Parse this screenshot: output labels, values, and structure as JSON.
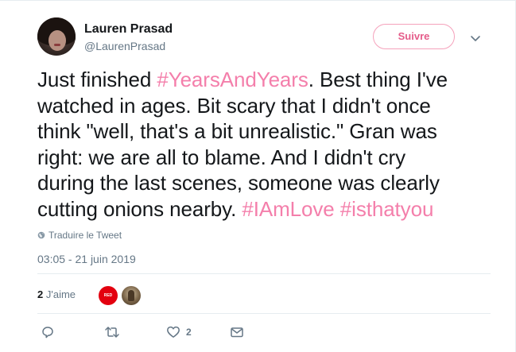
{
  "user": {
    "display_name": "Lauren Prasad",
    "handle": "@LaurenPrasad"
  },
  "follow_label": "Suivre",
  "tweet": {
    "lines": [
      [
        {
          "t": "Just finished ",
          "h": false
        },
        {
          "t": "#YearsAndYears",
          "h": true
        },
        {
          "t": ". Best thing I've",
          "h": false
        }
      ],
      [
        {
          "t": "watched in ages. Bit scary that I didn't once",
          "h": false
        }
      ],
      [
        {
          "t": "think \"well, that's a bit unrealistic.\" Gran was",
          "h": false
        }
      ],
      [
        {
          "t": "right: we are all to blame. And I didn't cry",
          "h": false
        }
      ],
      [
        {
          "t": "during the last scenes, someone was clearly",
          "h": false
        }
      ],
      [
        {
          "t": "cutting onions nearby. ",
          "h": false
        },
        {
          "t": "#IAmLove",
          "h": true
        },
        {
          "t": " ",
          "h": false
        },
        {
          "t": "#isthatyou",
          "h": true
        }
      ]
    ]
  },
  "translate_label": "Traduire le Tweet",
  "timestamp": "03:05 - 21 juin 2019",
  "likes": {
    "count": "2",
    "label": "J'aime",
    "liker_badge_text": "RED"
  },
  "actions": {
    "like_count": "2"
  },
  "colors": {
    "hashtag": "#f47fab",
    "follow_accent": "#e55c8a",
    "muted": "#657786",
    "text": "#14171a"
  },
  "icons": [
    "chevron-down-icon",
    "globe-icon",
    "reply-icon",
    "retweet-icon",
    "heart-icon",
    "envelope-icon"
  ]
}
